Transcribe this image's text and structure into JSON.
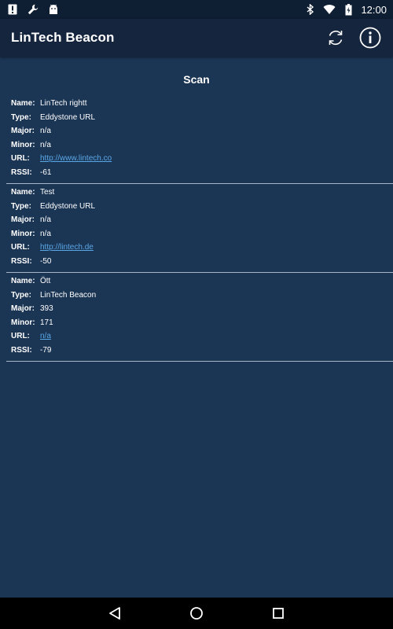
{
  "status_bar": {
    "time": "12:00",
    "left_icons": [
      "alert-icon",
      "wrench-icon",
      "android-icon"
    ],
    "right_icons": [
      "bluetooth-icon",
      "wifi-icon",
      "battery-icon"
    ]
  },
  "app_bar": {
    "title": "LinTech Beacon",
    "actions": [
      "refresh-icon",
      "info-icon"
    ]
  },
  "scan": {
    "title": "Scan",
    "labels": {
      "name": "Name:",
      "type": "Type:",
      "major": "Major:",
      "minor": "Minor:",
      "url": "URL:",
      "rssi": "RSSI:"
    },
    "beacons": [
      {
        "name": "LinTech rightt",
        "type": "Eddystone URL",
        "major": "n/a",
        "minor": "n/a",
        "url": "http://www.lintech.co",
        "rssi": "-61"
      },
      {
        "name": "Test",
        "type": "Eddystone URL",
        "major": "n/a",
        "minor": "n/a",
        "url": "http://lintech.de",
        "rssi": "-50"
      },
      {
        "name": "Ött",
        "type": "LinTech Beacon",
        "major": "393",
        "minor": "171",
        "url": "n/a",
        "rssi": "-79"
      }
    ]
  },
  "nav_bar": {
    "buttons": [
      "back-icon",
      "home-icon",
      "recents-icon"
    ]
  },
  "colors": {
    "background": "#1b3554",
    "app_bar": "#14253d",
    "status_bar": "#0e1e33",
    "link": "#5aa7e6",
    "divider": "#a8b6c7"
  }
}
